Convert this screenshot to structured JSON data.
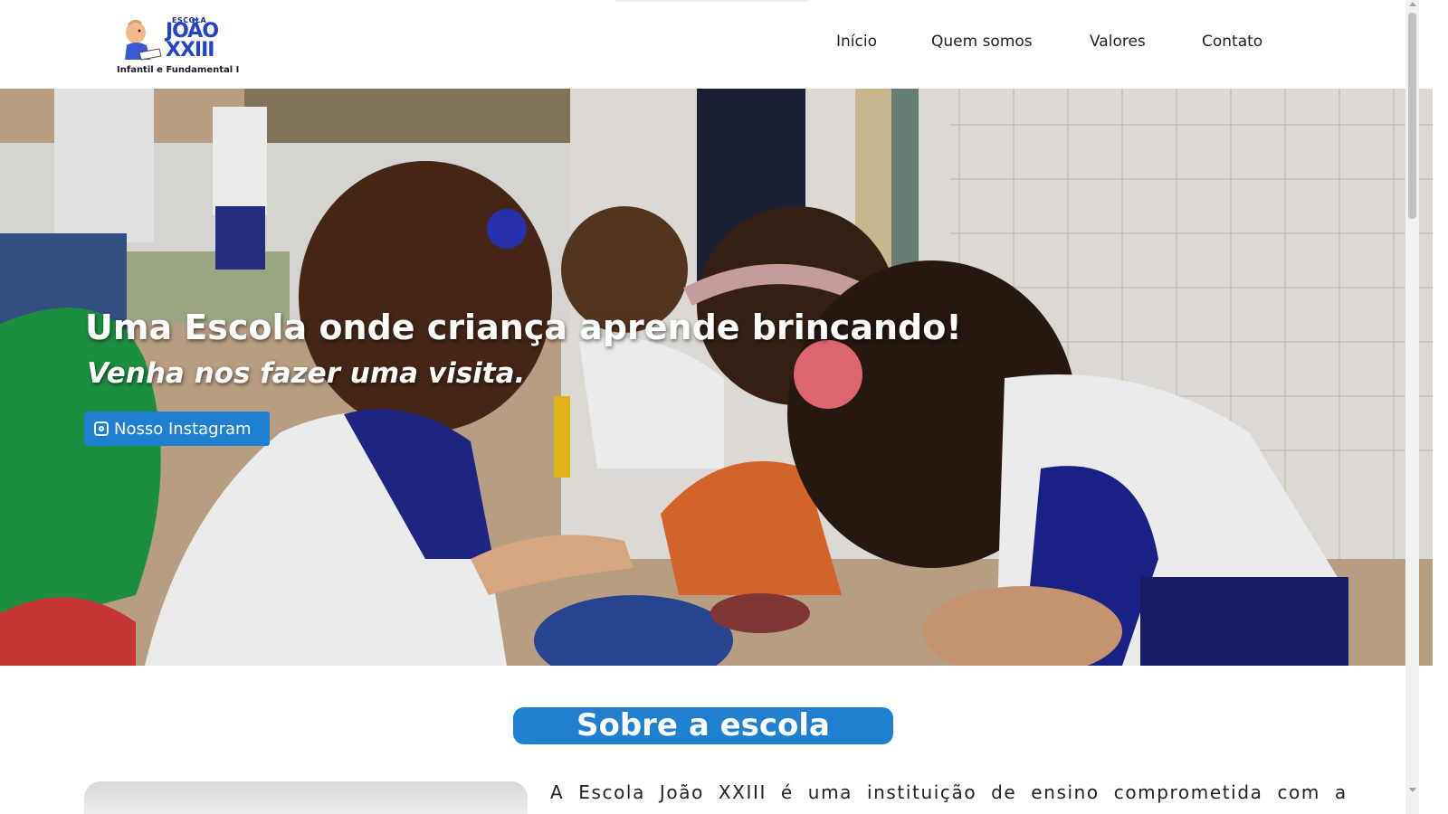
{
  "header": {
    "logo": {
      "escola": "ESCOLA",
      "name_line1": "JOÃO",
      "name_line2": "XXIII",
      "subtitle": "Infantil e Fundamental I",
      "icon": "child-reading-mascot-icon"
    },
    "nav": [
      {
        "label": "Início"
      },
      {
        "label": "Quem somos"
      },
      {
        "label": "Valores"
      },
      {
        "label": "Contato"
      }
    ]
  },
  "hero": {
    "title": "Uma Escola onde criança aprende brincando!",
    "subtitle": "Venha nos fazer uma visita.",
    "button_label": "Nosso Instagram",
    "button_icon": "instagram-icon"
  },
  "about": {
    "section_title": "Sobre a escola",
    "text": "A Escola João XXIII é uma instituição de ensino comprometida com a"
  },
  "colors": {
    "accent": "#1f7fd1",
    "logo_blue": "#2343c9"
  }
}
